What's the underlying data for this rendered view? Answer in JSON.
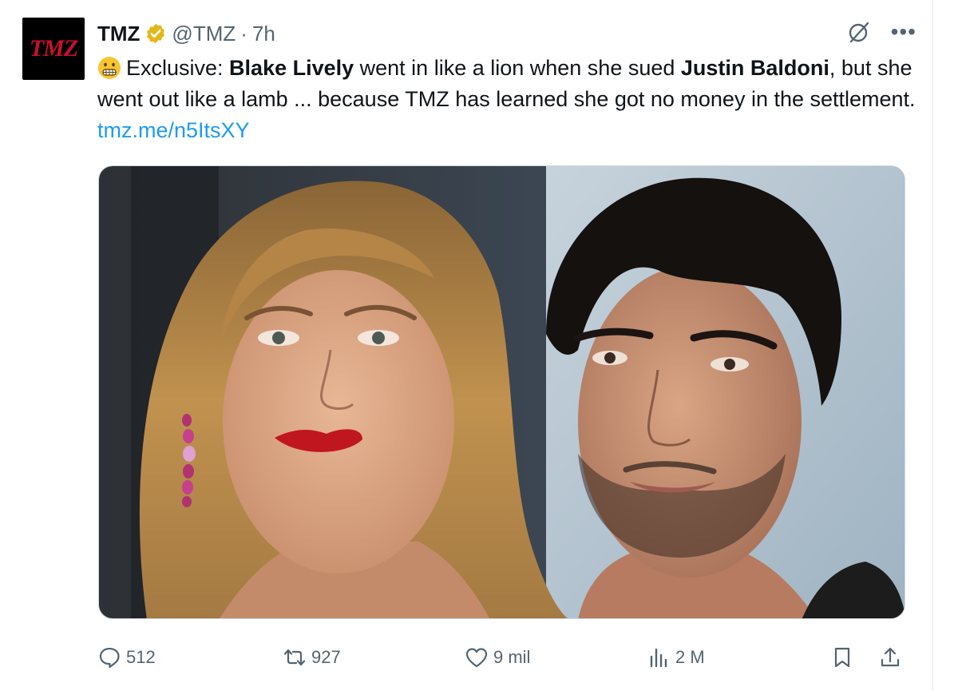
{
  "tweet": {
    "author_name": "TMZ",
    "handle": "@TMZ",
    "separator": "·",
    "time": "7h",
    "avatar_text": "TMZ",
    "text": {
      "t1": "Exclusive: ",
      "b1": "Blake Lively",
      "t2": " went in like a lion when she sued ",
      "b2": "Justin Baldoni",
      "t3": ", but she went out like a lamb ... because TMZ has learned she got no money in the settlement. ",
      "link": "tmz.me/n5ItsXY"
    }
  },
  "actions": {
    "replies": "512",
    "reposts": "927",
    "likes": "9 mil",
    "views": "2 M"
  },
  "colors": {
    "link": "#1d9bf0",
    "muted": "#536471",
    "verified_badge": "#e2b719",
    "avatar_bg": "#000000",
    "avatar_text": "#c8102e"
  },
  "icons": [
    "grimacing-emoji",
    "verified-badge-icon",
    "grok-icon",
    "more-icon",
    "reply-icon",
    "repost-icon",
    "like-icon",
    "views-icon",
    "bookmark-icon",
    "share-icon"
  ]
}
